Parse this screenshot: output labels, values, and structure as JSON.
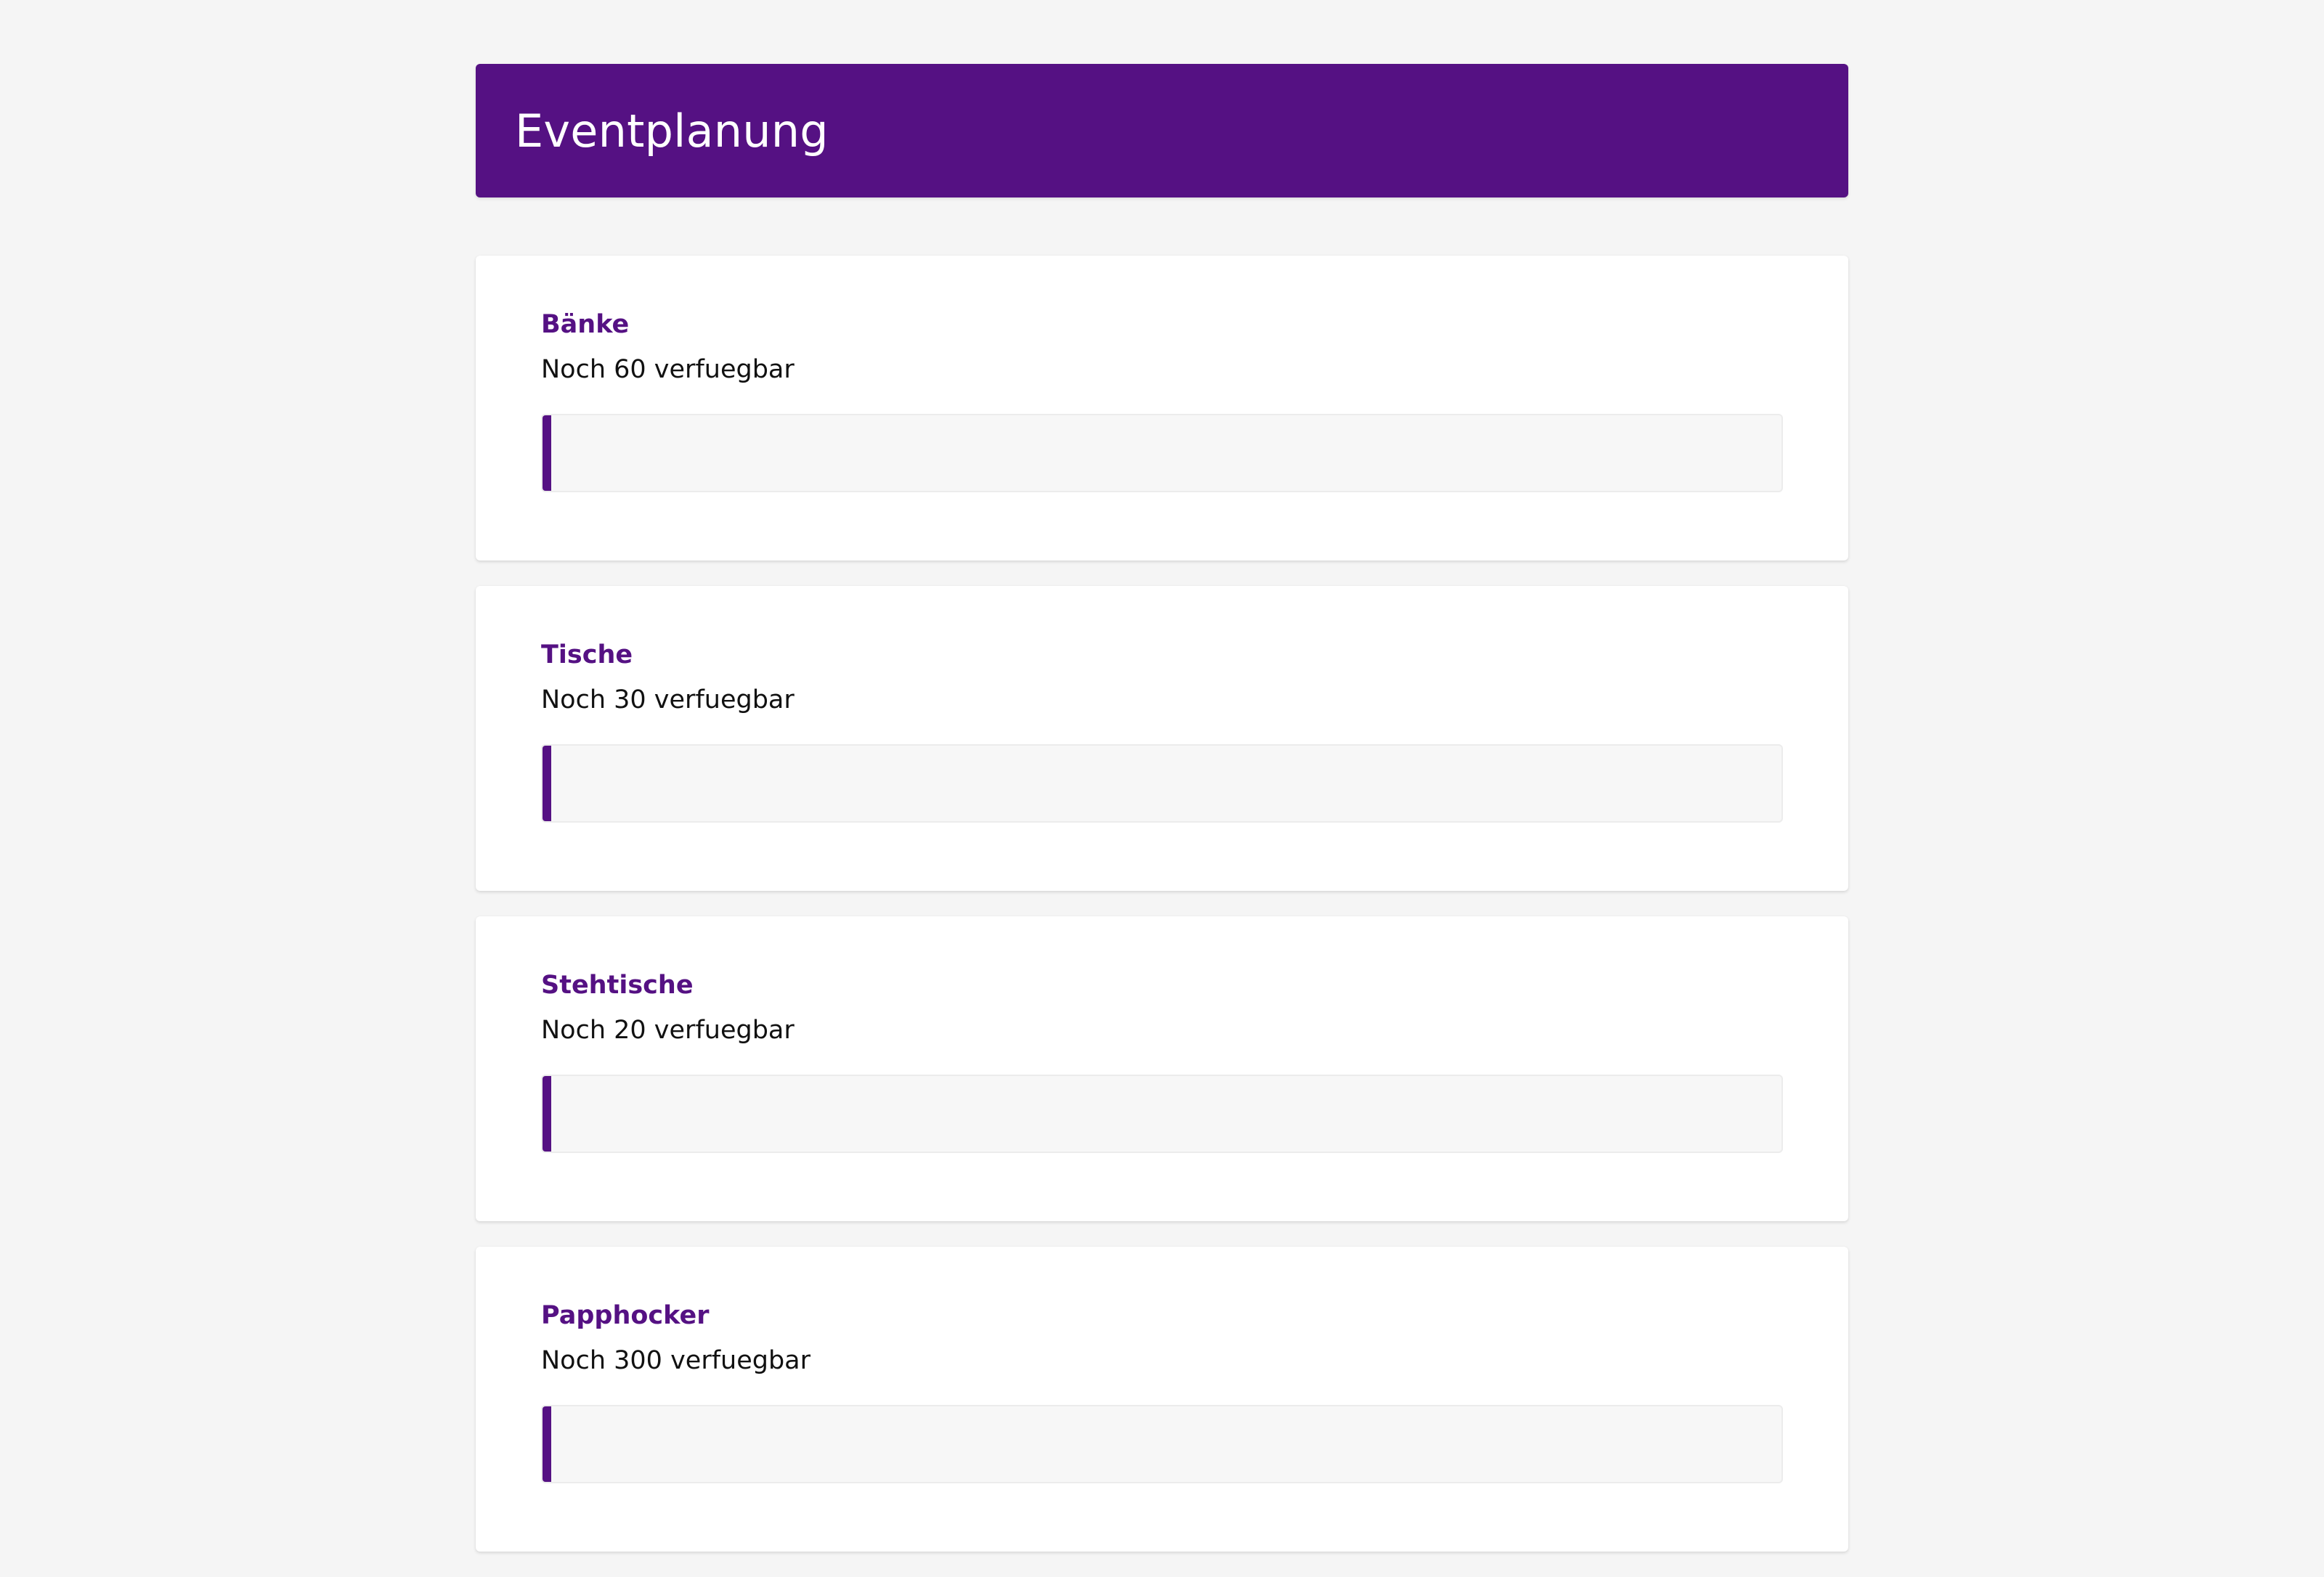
{
  "header": {
    "title": "Eventplanung"
  },
  "colors": {
    "accent": "#551183",
    "background": "#f5f5f5"
  },
  "items": [
    {
      "name": "Bänke",
      "availability": "Noch 60 verfuegbar",
      "progress": 0
    },
    {
      "name": "Tische",
      "availability": "Noch 30 verfuegbar",
      "progress": 0
    },
    {
      "name": "Stehtische",
      "availability": "Noch 20 verfuegbar",
      "progress": 0
    },
    {
      "name": "Papphocker",
      "availability": "Noch 300 verfuegbar",
      "progress": 0
    }
  ]
}
